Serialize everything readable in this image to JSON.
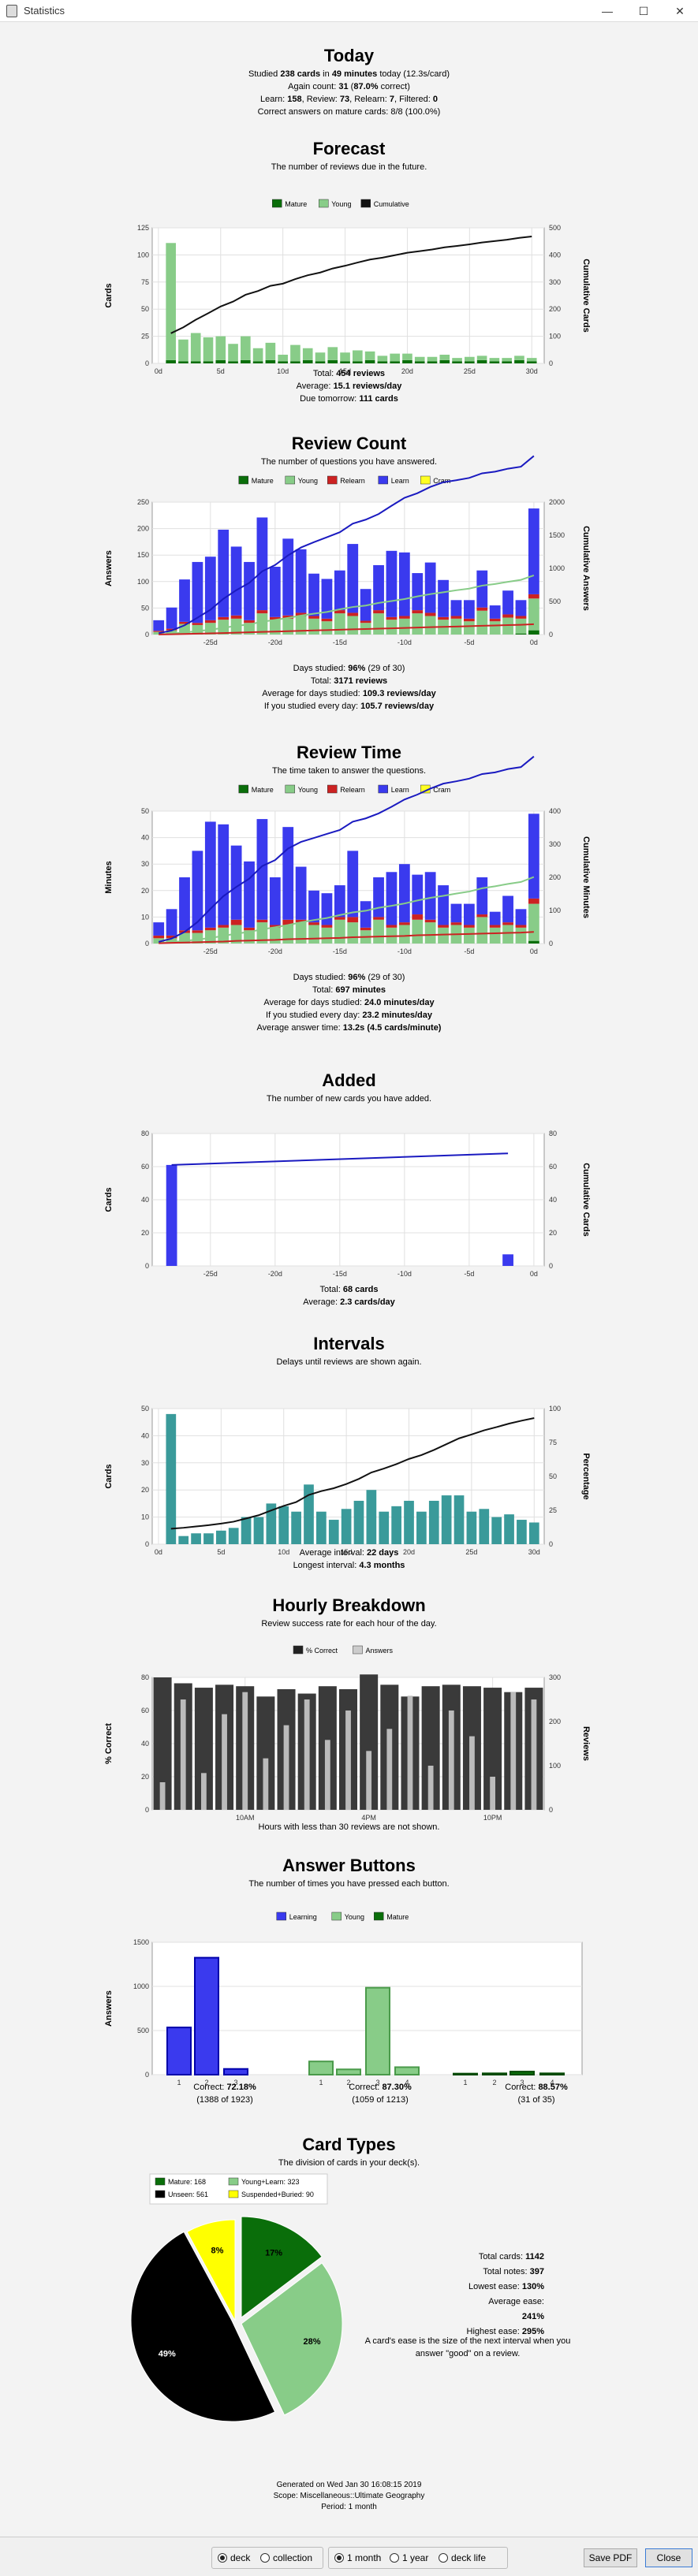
{
  "window": {
    "title": "Statistics",
    "minimize": "—",
    "maximize": "☐",
    "close": "✕"
  },
  "today": {
    "title": "Today",
    "line1": {
      "p1": "Studied ",
      "v1": "238 cards",
      "p2": " in ",
      "v2": "49 minutes",
      "p3": " today (12.3s/card)"
    },
    "line2": {
      "p1": "Again count: ",
      "v1": "31",
      "p2": " (",
      "v2": "87.0%",
      "p3": " correct)"
    },
    "line3": {
      "p1": "Learn: ",
      "v1": "158",
      "p2": ", Review: ",
      "v2": "73",
      "p3": ", Relearn: ",
      "v3": "7",
      "p4": ", Filtered: ",
      "v4": "0"
    },
    "line4": "Correct answers on mature cards: 8/8 (100.0%)"
  },
  "forecast": {
    "title": "Forecast",
    "subtitle": "The number of reviews due in the future.",
    "legend": [
      "Mature",
      "Young",
      "Cumulative"
    ],
    "ylabel": "Cards",
    "y2label": "Cumulative Cards",
    "yticks": [
      "0",
      "25",
      "50",
      "75",
      "100",
      "125"
    ],
    "y2ticks": [
      "0",
      "100",
      "200",
      "300",
      "400",
      "500"
    ],
    "xticks": [
      "0d",
      "5d",
      "10d",
      "15d",
      "20d",
      "25d",
      "30d"
    ],
    "total": {
      "label": "Total: ",
      "value": "454 reviews"
    },
    "average": {
      "label": "Average: ",
      "value": "15.1 reviews/day"
    },
    "tomorrow": {
      "label": "Due tomorrow: ",
      "value": "111 cards"
    }
  },
  "reviewcount": {
    "title": "Review Count",
    "subtitle": "The number of questions you have answered.",
    "legend": [
      "Mature",
      "Young",
      "Relearn",
      "Learn",
      "Cram"
    ],
    "ylabel": "Answers",
    "y2label": "Cumulative Answers",
    "yticks": [
      "0",
      "50",
      "100",
      "150",
      "200",
      "250"
    ],
    "y2ticks": [
      "0",
      "500",
      "1000",
      "1500",
      "2000"
    ],
    "xticks": [
      "-25d",
      "-20d",
      "-15d",
      "-10d",
      "-5d",
      "0d"
    ],
    "days": {
      "label": "Days studied: ",
      "value": "96%",
      "rest": " (29 of 30)"
    },
    "total": {
      "label": "Total: ",
      "value": "3171 reviews"
    },
    "avgdays": {
      "label": "Average for days studied: ",
      "value": "109.3 reviews/day"
    },
    "avgevery": {
      "label": "If you studied every day: ",
      "value": "105.7 reviews/day"
    }
  },
  "reviewtime": {
    "title": "Review Time",
    "subtitle": "The time taken to answer the questions.",
    "legend": [
      "Mature",
      "Young",
      "Relearn",
      "Learn",
      "Cram"
    ],
    "ylabel": "Minutes",
    "y2label": "Cumulative Minutes",
    "yticks": [
      "0",
      "10",
      "20",
      "30",
      "40",
      "50"
    ],
    "y2ticks": [
      "0",
      "100",
      "200",
      "300",
      "400"
    ],
    "xticks": [
      "-25d",
      "-20d",
      "-15d",
      "-10d",
      "-5d",
      "0d"
    ],
    "days": {
      "label": "Days studied: ",
      "value": "96%",
      "rest": " (29 of 30)"
    },
    "total": {
      "label": "Total: ",
      "value": "697 minutes"
    },
    "avgdays": {
      "label": "Average for days studied: ",
      "value": "24.0 minutes/day"
    },
    "avgevery": {
      "label": "If you studied every day: ",
      "value": "23.2 minutes/day"
    },
    "avganswer": {
      "label": "Average answer time: ",
      "value": "13.2s (4.5 cards/minute)"
    }
  },
  "added": {
    "title": "Added",
    "subtitle": "The number of new cards you have added.",
    "ylabel": "Cards",
    "y2label": "Cumulative Cards",
    "yticks": [
      "0",
      "20",
      "40",
      "60",
      "80"
    ],
    "y2ticks": [
      "0",
      "20",
      "40",
      "60",
      "80"
    ],
    "xticks": [
      "-25d",
      "-20d",
      "-15d",
      "-10d",
      "-5d",
      "0d"
    ],
    "total": {
      "label": "Total: ",
      "value": "68 cards"
    },
    "average": {
      "label": "Average: ",
      "value": "2.3 cards/day"
    }
  },
  "intervals": {
    "title": "Intervals",
    "subtitle": "Delays until reviews are shown again.",
    "ylabel": "Cards",
    "y2label": "Percentage",
    "yticks": [
      "0",
      "10",
      "20",
      "30",
      "40",
      "50"
    ],
    "y2ticks": [
      "0",
      "25",
      "50",
      "75",
      "100"
    ],
    "xticks": [
      "0d",
      "5d",
      "10d",
      "15d",
      "20d",
      "25d",
      "30d"
    ],
    "average": {
      "label": "Average interval: ",
      "value": "22 days"
    },
    "longest": {
      "label": "Longest interval: ",
      "value": "4.3 months"
    }
  },
  "hourly": {
    "title": "Hourly Breakdown",
    "subtitle": "Review success rate for each hour of the day.",
    "legend": [
      "% Correct",
      "Answers"
    ],
    "ylabel": "% Correct",
    "y2label": "Reviews",
    "yticks": [
      "0",
      "20",
      "40",
      "60",
      "80"
    ],
    "y2ticks": [
      "0",
      "100",
      "200",
      "300"
    ],
    "xticks": [
      "10AM",
      "4PM",
      "10PM"
    ],
    "note": "Hours with less than 30 reviews are not shown."
  },
  "buttons": {
    "title": "Answer Buttons",
    "subtitle": "The number of times you have pressed each button.",
    "legend": [
      "Learning",
      "Young",
      "Mature"
    ],
    "ylabel": "Answers",
    "yticks": [
      "0",
      "500",
      "1000",
      "1500"
    ],
    "xticks": [
      "1",
      "2",
      "3",
      "1",
      "2",
      "3",
      "4",
      "1",
      "2",
      "3",
      "4"
    ],
    "learning": {
      "label": "Correct: ",
      "value": "72.18%",
      "sub": "(1388 of 1923)"
    },
    "young": {
      "label": "Correct: ",
      "value": "87.30%",
      "sub": "(1059 of 1213)"
    },
    "mature": {
      "label": "Correct: ",
      "value": "88.57%",
      "sub": "(31 of 35)"
    }
  },
  "cardtypes": {
    "title": "Card Types",
    "subtitle": "The division of cards in your deck(s).",
    "legend": [
      "Mature: 168",
      "Young+Learn: 323",
      "Unseen: 561",
      "Suspended+Buried: 90"
    ],
    "slice_labels": [
      "17%",
      "28%",
      "49%",
      "8%"
    ],
    "total_cards": {
      "label": "Total cards: ",
      "value": "1142"
    },
    "total_notes": {
      "label": "Total notes: ",
      "value": "397"
    },
    "lowest": {
      "label": "Lowest ease: ",
      "value": "130%"
    },
    "average": {
      "label": "Average ease: ",
      "value": "241%"
    },
    "highest": {
      "label": "Highest ease: ",
      "value": "295%"
    },
    "note": "A card's ease is the size of the next interval when you answer \"good\" on a review."
  },
  "footer": {
    "generated": "Generated on Wed Jan 30 16:08:15 2019",
    "scope": "Scope: Miscellaneous::Ultimate Geography",
    "period": "Period: 1 month"
  },
  "bottombar": {
    "deck": "deck",
    "collection": "collection",
    "month": "1 month",
    "year": "1 year",
    "decklife": "deck life",
    "save_pdf": "Save PDF",
    "close": "Close"
  },
  "colors": {
    "mature": "#0a6e0a",
    "young": "#88cc88",
    "relearn": "#cc2222",
    "learn": "#3a3aee",
    "cram": "#ffff22",
    "teal": "#3a9a9a",
    "unseen": "#000000",
    "suspended": "#ffff00"
  },
  "chart_data": [
    {
      "type": "bar",
      "id": "forecast",
      "x": [
        0,
        1,
        2,
        3,
        4,
        5,
        6,
        7,
        8,
        9,
        10,
        11,
        12,
        13,
        14,
        15,
        16,
        17,
        18,
        19,
        20,
        21,
        22,
        23,
        24,
        25,
        26,
        27,
        28,
        29,
        30
      ],
      "series": [
        {
          "name": "Mature",
          "values": [
            0,
            3,
            2,
            2,
            2,
            3,
            2,
            3,
            2,
            3,
            2,
            2,
            3,
            2,
            3,
            2,
            2,
            3,
            2,
            2,
            3,
            2,
            2,
            3,
            2,
            2,
            3,
            2,
            2,
            3,
            2
          ]
        },
        {
          "name": "Young",
          "values": [
            0,
            108,
            20,
            26,
            22,
            22,
            16,
            22,
            12,
            16,
            6,
            15,
            11,
            8,
            12,
            8,
            10,
            8,
            5,
            7,
            6,
            4,
            4,
            5,
            3,
            4,
            4,
            3,
            3,
            4,
            3
          ]
        },
        {
          "name": "Cumulative",
          "values": [
            0,
            111,
            133,
            161,
            185,
            210,
            228,
            253,
            267,
            286,
            294,
            311,
            325,
            335,
            350,
            360,
            372,
            383,
            390,
            399,
            408,
            414,
            420,
            428,
            433,
            439,
            446,
            451,
            456,
            463,
            468
          ]
        }
      ],
      "ylim": [
        0,
        125
      ],
      "y2lim": [
        0,
        500
      ]
    },
    {
      "type": "bar",
      "id": "reviewcount",
      "x": [
        -29,
        -28,
        -27,
        -26,
        -25,
        -24,
        -23,
        -22,
        -21,
        -20,
        -19,
        -18,
        -17,
        -16,
        -15,
        -14,
        -13,
        -12,
        -11,
        -10,
        -9,
        -8,
        -7,
        -6,
        -5,
        -4,
        -3,
        -2,
        -1,
        0
      ],
      "series": [
        {
          "name": "Mature",
          "values": [
            0,
            0,
            0,
            0,
            0,
            0,
            0,
            0,
            0,
            0,
            0,
            0,
            0,
            0,
            0,
            0,
            0,
            0,
            0,
            0,
            0,
            0,
            0,
            0,
            0,
            0,
            0,
            0,
            2,
            8
          ]
        },
        {
          "name": "Young",
          "values": [
            5,
            8,
            20,
            18,
            22,
            28,
            30,
            22,
            40,
            28,
            30,
            35,
            30,
            25,
            40,
            35,
            22,
            40,
            28,
            30,
            40,
            35,
            28,
            30,
            25,
            45,
            25,
            32,
            28,
            60
          ]
        },
        {
          "name": "Relearn",
          "values": [
            2,
            3,
            4,
            4,
            5,
            5,
            6,
            5,
            6,
            5,
            6,
            6,
            5,
            5,
            6,
            6,
            4,
            6,
            5,
            5,
            6,
            6,
            5,
            5,
            5,
            6,
            5,
            6,
            5,
            8
          ]
        },
        {
          "name": "Learn",
          "values": [
            20,
            40,
            80,
            115,
            120,
            165,
            130,
            110,
            175,
            95,
            145,
            120,
            80,
            75,
            75,
            130,
            60,
            85,
            125,
            120,
            70,
            95,
            70,
            30,
            35,
            70,
            25,
            45,
            30,
            162
          ]
        },
        {
          "name": "Cram",
          "values": [
            0,
            0,
            0,
            0,
            0,
            0,
            0,
            0,
            0,
            0,
            0,
            0,
            0,
            0,
            0,
            0,
            0,
            0,
            0,
            0,
            0,
            0,
            0,
            0,
            0,
            0,
            0,
            0,
            0,
            0
          ]
        }
      ],
      "ylim": [
        0,
        250
      ],
      "y2lim": [
        0,
        2000
      ]
    },
    {
      "type": "bar",
      "id": "reviewtime",
      "x": [
        -29,
        -28,
        -27,
        -26,
        -25,
        -24,
        -23,
        -22,
        -21,
        -20,
        -19,
        -18,
        -17,
        -16,
        -15,
        -14,
        -13,
        -12,
        -11,
        -10,
        -9,
        -8,
        -7,
        -6,
        -5,
        -4,
        -3,
        -2,
        -1,
        0
      ],
      "series": [
        {
          "name": "Mature",
          "values": [
            0,
            0,
            0,
            0,
            0,
            0,
            0,
            0,
            0,
            0,
            0,
            0,
            0,
            0,
            0,
            0,
            0,
            0,
            0,
            0,
            0,
            0,
            0,
            0,
            0,
            0,
            0,
            0,
            0,
            1
          ]
        },
        {
          "name": "Young",
          "values": [
            2,
            2,
            4,
            4,
            5,
            6,
            7,
            5,
            8,
            6,
            7,
            8,
            7,
            6,
            9,
            8,
            5,
            9,
            6,
            7,
            9,
            8,
            6,
            7,
            6,
            10,
            6,
            7,
            6,
            14
          ]
        },
        {
          "name": "Relearn",
          "values": [
            1,
            1,
            1,
            1,
            1,
            1,
            2,
            1,
            1,
            1,
            2,
            1,
            1,
            1,
            1,
            2,
            1,
            1,
            1,
            1,
            2,
            1,
            1,
            1,
            1,
            1,
            1,
            1,
            1,
            2
          ]
        },
        {
          "name": "Learn",
          "values": [
            5,
            10,
            20,
            30,
            40,
            38,
            28,
            25,
            38,
            18,
            35,
            20,
            12,
            12,
            12,
            25,
            10,
            15,
            20,
            22,
            15,
            18,
            15,
            7,
            8,
            14,
            5,
            10,
            6,
            32
          ]
        },
        {
          "name": "Cram",
          "values": [
            0,
            0,
            0,
            0,
            0,
            0,
            0,
            0,
            0,
            0,
            0,
            0,
            0,
            0,
            0,
            0,
            0,
            0,
            0,
            0,
            0,
            0,
            0,
            0,
            0,
            0,
            0,
            0,
            0,
            0
          ]
        }
      ],
      "ylim": [
        0,
        50
      ],
      "y2lim": [
        0,
        400
      ]
    },
    {
      "type": "bar",
      "id": "added",
      "x": [
        -28,
        -2
      ],
      "series": [
        {
          "name": "Cards",
          "values": [
            61,
            7
          ]
        }
      ],
      "ylim": [
        0,
        80
      ],
      "y2lim": [
        0,
        80
      ]
    },
    {
      "type": "bar",
      "id": "intervals",
      "x": [
        1,
        2,
        3,
        4,
        5,
        6,
        7,
        8,
        9,
        10,
        11,
        12,
        13,
        14,
        15,
        16,
        17,
        18,
        19,
        20,
        21,
        22,
        23,
        24,
        25,
        26,
        27,
        28,
        29,
        30
      ],
      "values": [
        48,
        3,
        4,
        4,
        5,
        6,
        10,
        10,
        15,
        14,
        12,
        22,
        12,
        9,
        13,
        16,
        20,
        12,
        14,
        16,
        12,
        16,
        18,
        18,
        12,
        13,
        10,
        11,
        9,
        8
      ],
      "ylim": [
        0,
        50
      ]
    },
    {
      "type": "bar",
      "id": "hourly",
      "x": [
        6,
        7,
        8,
        9,
        10,
        11,
        12,
        13,
        14,
        15,
        16,
        17,
        18,
        19,
        20,
        21,
        22,
        23,
        24
      ],
      "series": [
        {
          "name": "% Correct",
          "values": [
            90,
            86,
            83,
            85,
            84,
            77,
            82,
            79,
            84,
            82,
            92,
            85,
            77,
            84,
            85,
            84,
            83,
            80,
            83
          ]
        },
        {
          "name": "Answers",
          "values": [
            75,
            300,
            100,
            260,
            320,
            140,
            230,
            300,
            190,
            270,
            160,
            220,
            310,
            120,
            270,
            200,
            90,
            320,
            300
          ]
        }
      ],
      "ylim": [
        0,
        90
      ],
      "y2lim": [
        0,
        360
      ]
    },
    {
      "type": "bar",
      "id": "buttons",
      "categories": [
        "L1",
        "L2",
        "L3",
        "Y1",
        "Y2",
        "Y3",
        "Y4",
        "M1",
        "M2",
        "M3",
        "M4"
      ],
      "values": [
        535,
        1325,
        65,
        150,
        60,
        985,
        85,
        12,
        15,
        35,
        15
      ],
      "ylim": [
        0,
        1500
      ]
    },
    {
      "type": "pie",
      "id": "cardtypes",
      "labels": [
        "Mature",
        "Young+Learn",
        "Unseen",
        "Suspended+Buried"
      ],
      "values": [
        168,
        323,
        561,
        90
      ]
    }
  ]
}
